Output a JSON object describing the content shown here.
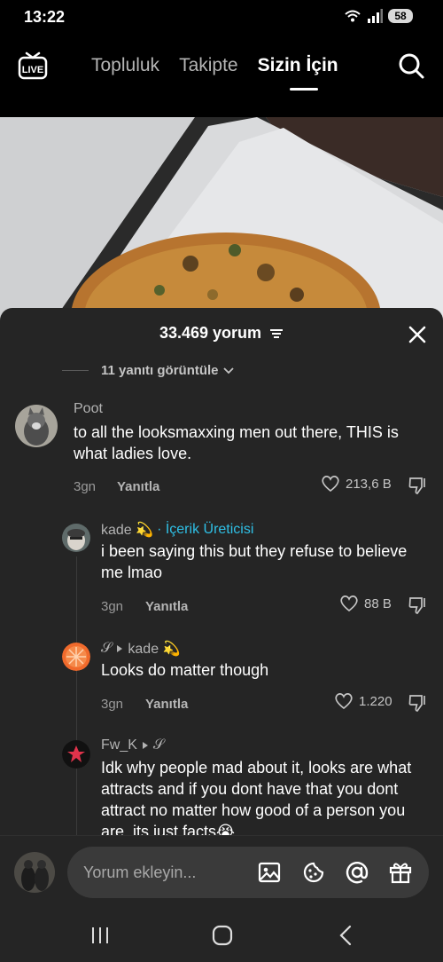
{
  "status": {
    "time": "13:22",
    "battery": "58"
  },
  "topnav": {
    "tabs": [
      {
        "label": "Topluluk"
      },
      {
        "label": "Takipte"
      },
      {
        "label": "Sizin İçin"
      }
    ]
  },
  "sheet": {
    "title": "33.469 yorum",
    "view_replies": "11 yanıtı görüntüle"
  },
  "comments": [
    {
      "user": "Poot",
      "text": "to all the looksmaxxing men out there, THIS is what ladies love.",
      "time": "3gn",
      "reply": "Yanıtla",
      "likes": "213,6 B"
    },
    {
      "user": "kade 💫",
      "badge": "· İçerik Üreticisi",
      "text": "i been saying this but they refuse to believe me lmao",
      "time": "3gn",
      "reply": "Yanıtla",
      "likes": "88 B"
    },
    {
      "user": "𝒮",
      "reply_to": "kade 💫",
      "text": "Looks do matter though",
      "time": "3gn",
      "reply": "Yanıtla",
      "likes": "1.220"
    },
    {
      "user": "Fw_K",
      "reply_to": "𝒮",
      "text": "Idk why people mad about it, looks are what attracts and if you dont have that you dont attract no matter how good of a person you are, its just facts😭"
    }
  ],
  "input": {
    "placeholder": "Yorum ekleyin..."
  },
  "colors": {
    "sheet_bg": "#252525",
    "creator_badge": "#2fc0e6"
  }
}
